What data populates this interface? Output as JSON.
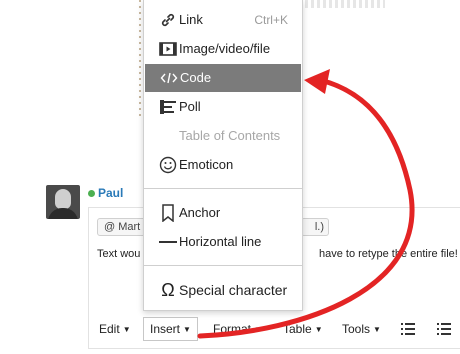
{
  "menu": {
    "items": [
      {
        "label": "Link",
        "shortcut": "Ctrl+K",
        "icon": "link-icon"
      },
      {
        "label": "Image/video/file",
        "icon": "media-icon"
      },
      {
        "label": "Code",
        "icon": "code-icon"
      },
      {
        "label": "Poll",
        "icon": "poll-icon"
      },
      {
        "label": "Table of Contents"
      },
      {
        "label": "Emoticon",
        "icon": "emoticon-icon"
      },
      {
        "label": "Anchor",
        "icon": "anchor-bookmark-icon"
      },
      {
        "label": "Horizontal line",
        "icon": "horizontal-line-icon"
      },
      {
        "label": "Special character",
        "icon": "omega-icon"
      }
    ],
    "selected": "Code",
    "disabled": [
      "Table of Contents"
    ]
  },
  "comment": {
    "username": "Paul",
    "mention_left": "@ Mart",
    "mention_right": "l.)",
    "text_left": "Text wou",
    "text_right": "have to retype the entire file!"
  },
  "toolbar": {
    "edit": "Edit",
    "insert": "Insert",
    "format": "Format",
    "table": "Table",
    "tools": "Tools"
  },
  "colors": {
    "annotation_arrow": "#e32424",
    "selected_item_bg": "#7b7b7b",
    "username": "#2a7ab8",
    "presence": "#4caf50"
  }
}
